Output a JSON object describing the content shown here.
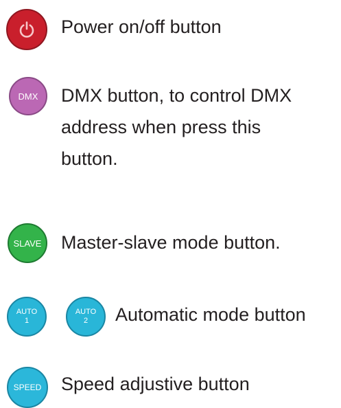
{
  "colors": {
    "power": "#c91f2c",
    "power_border": "#8f1720",
    "dmx": "#bb68b4",
    "dmx_border": "#8a4a86",
    "slave": "#33b34a",
    "slave_border": "#1e7a31",
    "auto": "#29b6d8",
    "auto_border": "#1a86a3",
    "speed": "#2bb7da",
    "speed_border": "#1a86a3",
    "text": "#231f20"
  },
  "items": [
    {
      "button": {
        "icon": "power-icon"
      },
      "lines": [
        "Power on/off button"
      ]
    },
    {
      "button": {
        "label": "DMX"
      },
      "lines": [
        "DMX button, to control DMX",
        "address when press this",
        "button."
      ]
    },
    {
      "button": {
        "label": "SLAVE"
      },
      "lines": [
        "Master-slave mode button."
      ]
    },
    {
      "buttons": [
        {
          "label": "AUTO",
          "sub": "1"
        },
        {
          "label": "AUTO",
          "sub": "2"
        }
      ],
      "lines": [
        "Automatic mode button"
      ]
    },
    {
      "button": {
        "label": "SPEED"
      },
      "lines": [
        "Speed adjustive button"
      ]
    }
  ]
}
